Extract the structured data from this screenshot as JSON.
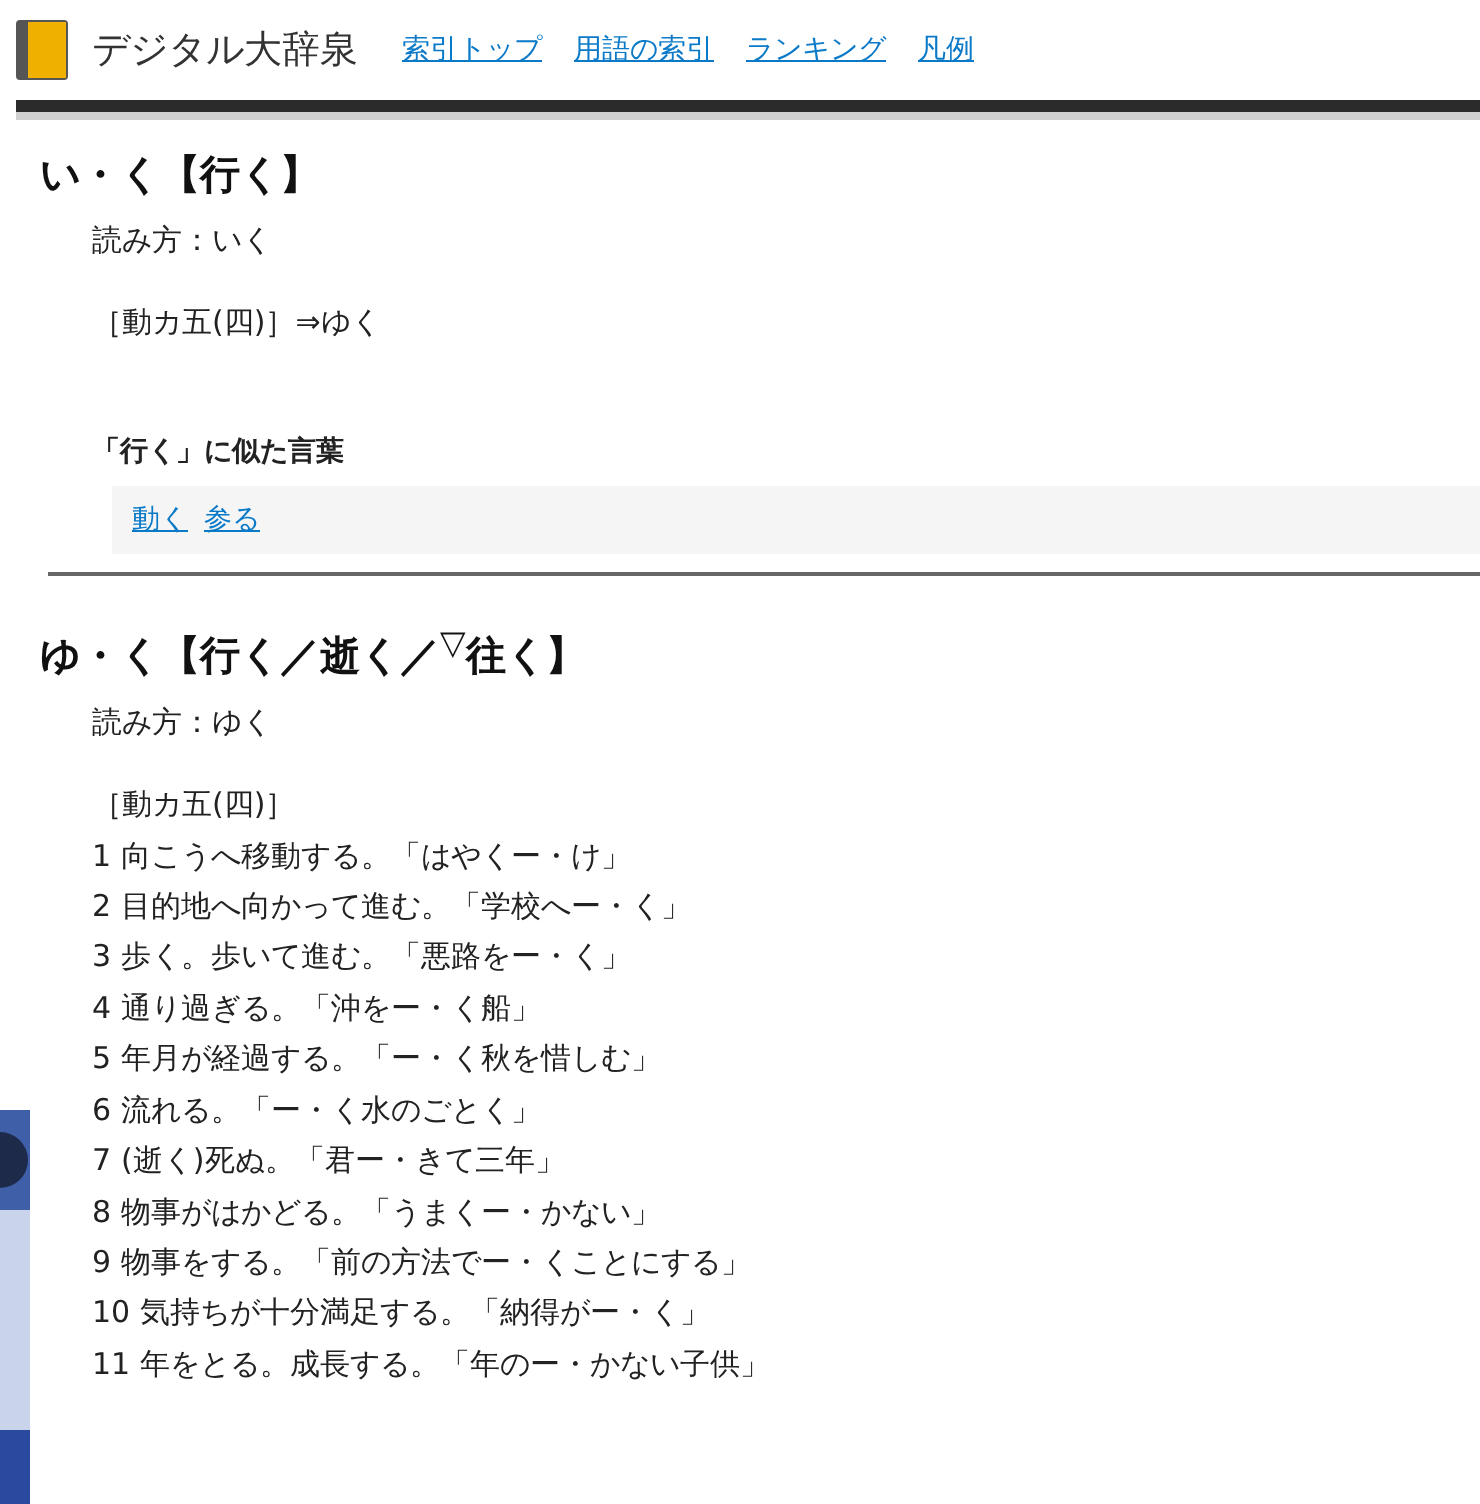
{
  "header": {
    "site_title": "デジタル大辞泉",
    "links": [
      "索引トップ",
      "用語の索引",
      "ランキング",
      "凡例"
    ]
  },
  "entries": [
    {
      "headword": "い・く【行く】",
      "reading": "読み方：いく",
      "definition_header": "［動カ五(四)］⇒ゆく",
      "similar_title": "「行く」に似た言葉",
      "similar_words": [
        "動く",
        "参る"
      ]
    },
    {
      "headword": "ゆ・く【行く／逝く／$^{▽}$往く】",
      "reading": "読み方：ゆく",
      "definition_header": "［動カ五(四)］",
      "senses": [
        {
          "number": "1",
          "text": "向こうへ移動する。「はやくー・け」"
        },
        {
          "number": "2",
          "text": "目的地へ向かって進む。「学校へー・く」"
        },
        {
          "number": "3",
          "text": "歩く。歩いて進む。「悪路をー・く」"
        },
        {
          "number": "4",
          "text": "通り過ぎる。「沖をー・く船」"
        },
        {
          "number": "5",
          "text": "年月が経過する。「ー・く秋を惜しむ」"
        },
        {
          "number": "6",
          "text": "流れる。「ー・く水のごとく」"
        },
        {
          "number": "7",
          "text": "(逝く)死ぬ。「君ー・きて三年」"
        },
        {
          "number": "8",
          "text": "物事がはかどる。「うまくー・かない」"
        },
        {
          "number": "9",
          "text": "物事をする。「前の方法でー・くことにする」"
        },
        {
          "number": "10",
          "text": "気持ちが十分満足する。「納得がー・く」"
        },
        {
          "number": "11",
          "text": "年をとる。成長する。「年のー・かない子供」"
        }
      ]
    }
  ]
}
